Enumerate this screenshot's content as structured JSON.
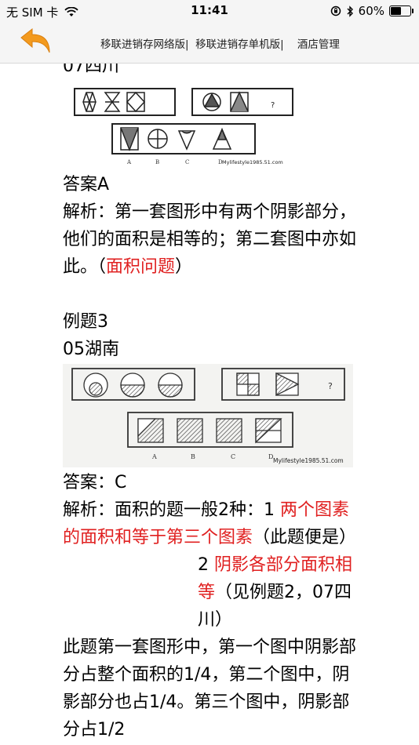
{
  "status": {
    "carrier": "无 SIM 卡",
    "time": "11:41",
    "battery": "60%",
    "battery_level": 0.6
  },
  "nav": {
    "links": [
      "移联进销存网络版|",
      "移联进销存单机版|",
      "酒店管理"
    ]
  },
  "article": {
    "partial_heading": "07四川",
    "fig1": {
      "watermark": "Mylifestyle1985.51.com",
      "question_mark": "?",
      "option_labels": [
        "A",
        "B",
        "C",
        "D"
      ]
    },
    "answer1": "答案A",
    "analysis1_text": "解析：第一套图形中有两个阴影部分，他们的面积是相等的；第二套图中亦如此。（",
    "analysis1_red": "面积问题",
    "analysis1_tail": "）",
    "example_title": "例题3",
    "example_source": "05湖南",
    "fig2": {
      "watermark": "Mylifestyle1985.51.com",
      "question_mark": "?",
      "option_labels": [
        "A",
        "B",
        "C",
        "D"
      ]
    },
    "answer2": "答案：C",
    "analysis2_a": "解析：面积的题一般2种：1 ",
    "analysis2_red1": "两个图素的面积和等于第三个图素",
    "analysis2_b": "（此题便是）",
    "analysis2_num": "2 ",
    "analysis2_red2": "阴影各部分面积相等",
    "analysis2_c": "（见例题2，07四川）",
    "body_text": "此题第一套图形中，第一个图中阴影部分占整个面积的1/4，第二个图中，阴影部分也占1/4。第三个图中，阴影部分占1/2"
  }
}
